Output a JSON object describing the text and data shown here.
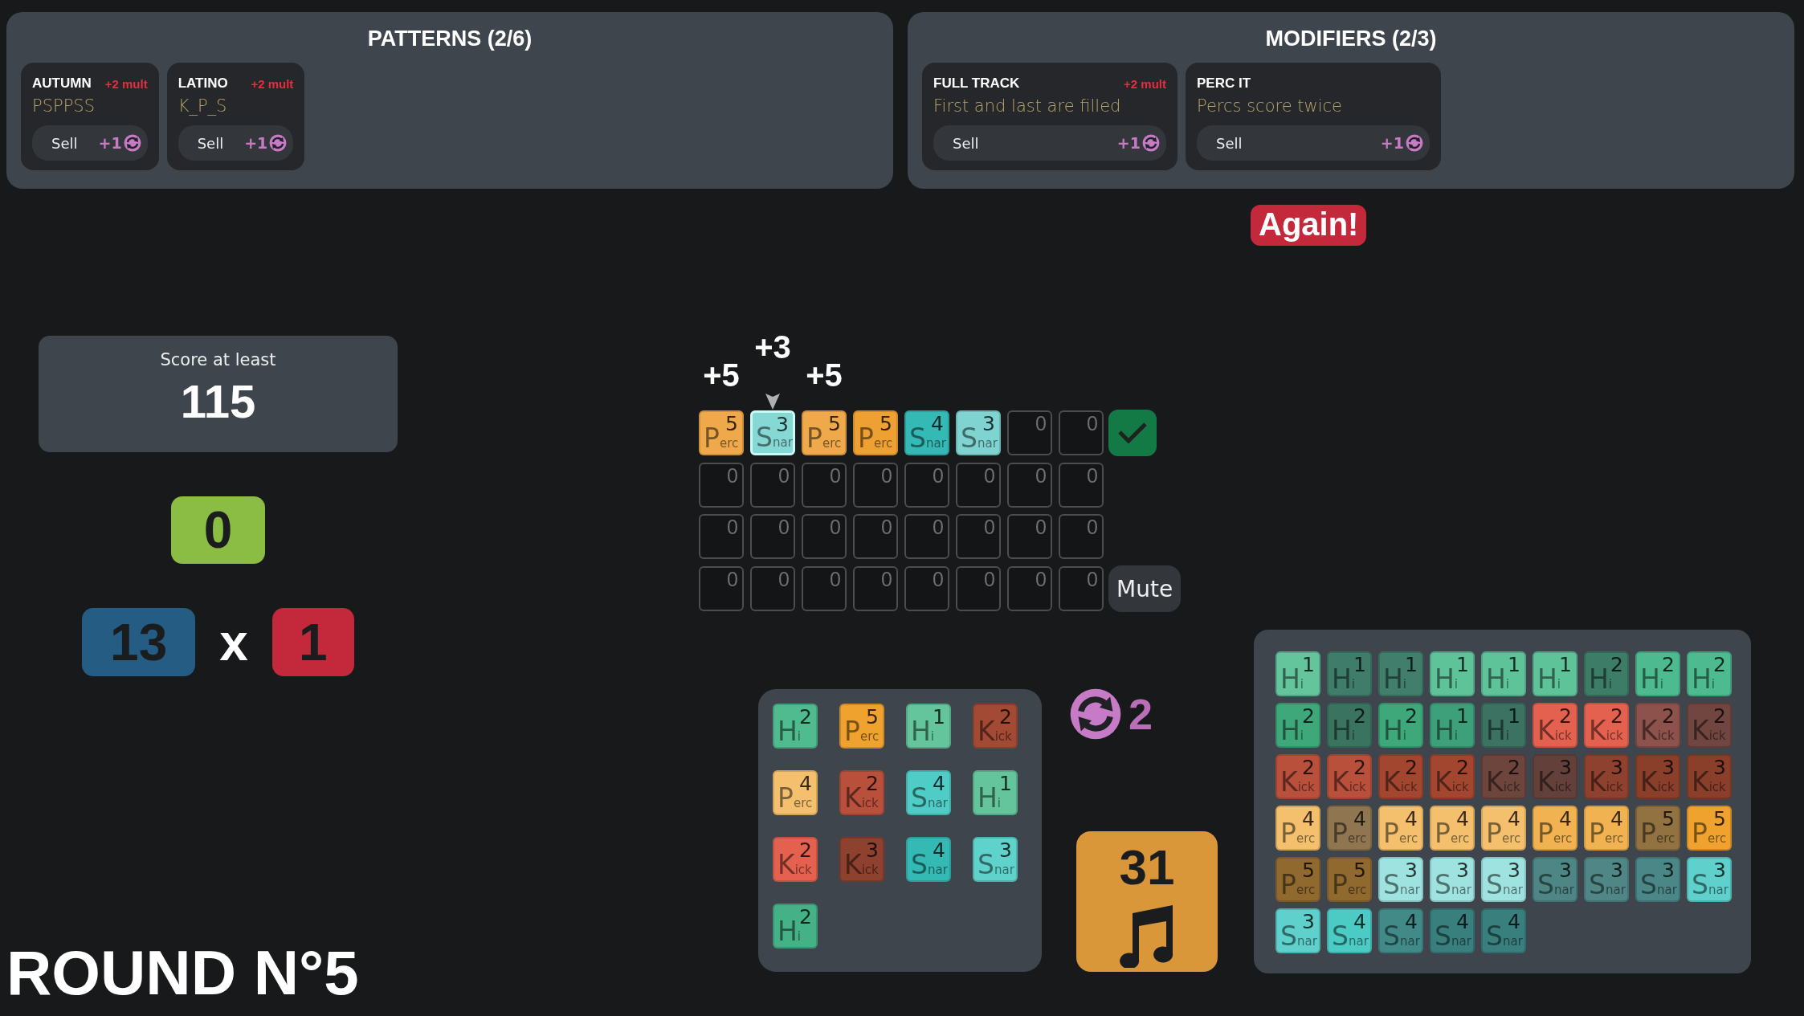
{
  "patterns": {
    "title": "PATTERNS (2/6)",
    "cards": [
      {
        "name": "AUTUMN",
        "bonus": "+2 mult",
        "description": "PSPPSS",
        "sell_label": "Sell",
        "sell_value": "+1"
      },
      {
        "name": "LATINO",
        "bonus": "+2 mult",
        "description": "K_P_S",
        "sell_label": "Sell",
        "sell_value": "+1"
      }
    ]
  },
  "modifiers": {
    "title": "MODIFIERS (2/3)",
    "cards": [
      {
        "name": "FULL TRACK",
        "bonus": "+2 mult",
        "description": "First and last are filled",
        "sell_label": "Sell",
        "sell_value": "+1"
      },
      {
        "name": "PERC IT",
        "description": "Percs score twice",
        "sell_label": "Sell",
        "sell_value": "+1"
      }
    ]
  },
  "again_badge": "Again!",
  "target": {
    "label": "Score at least",
    "value": "115"
  },
  "score": "0",
  "chips": "13",
  "times": "x",
  "mult": "1",
  "round_title": "ROUND N°5",
  "grid": {
    "rows": [
      {
        "cells": [
          {
            "kind": "tile",
            "label": "P$_{erc}$",
            "value": "5",
            "color": "#efa94a",
            "selected": false,
            "popup": "+5"
          },
          {
            "kind": "tile",
            "label": "S$_{nar}$",
            "value": "3",
            "color": "#86d8d5",
            "selected": true,
            "popup": "+3"
          },
          {
            "kind": "tile",
            "label": "P$_{erc}$",
            "value": "5",
            "color": "#efa94a",
            "selected": false,
            "popup": "+5"
          },
          {
            "kind": "tile",
            "label": "P$_{erc}$",
            "value": "5",
            "color": "#eea132",
            "selected": false
          },
          {
            "kind": "tile",
            "label": "S$_{nar}$",
            "value": "4",
            "color": "#35b9b4",
            "selected": false
          },
          {
            "kind": "tile",
            "label": "S$_{nar}$",
            "value": "3",
            "color": "#7fd4d1",
            "selected": false
          },
          {
            "kind": "empty",
            "value": "0",
            "selected": false
          },
          {
            "kind": "empty",
            "value": "0",
            "selected": false
          }
        ],
        "action": {
          "kind": "confirm"
        }
      },
      {
        "cells": [
          {
            "kind": "empty",
            "value": "0",
            "selected": false
          },
          {
            "kind": "empty",
            "value": "0",
            "selected": false
          },
          {
            "kind": "empty",
            "value": "0",
            "selected": false
          },
          {
            "kind": "empty",
            "value": "0",
            "selected": false
          },
          {
            "kind": "empty",
            "value": "0",
            "selected": false
          },
          {
            "kind": "empty",
            "value": "0",
            "selected": false
          },
          {
            "kind": "empty",
            "value": "0",
            "selected": false
          },
          {
            "kind": "empty",
            "value": "0",
            "selected": false
          }
        ]
      },
      {
        "cells": [
          {
            "kind": "empty",
            "value": "0",
            "selected": false
          },
          {
            "kind": "empty",
            "value": "0",
            "selected": false
          },
          {
            "kind": "empty",
            "value": "0",
            "selected": false
          },
          {
            "kind": "empty",
            "value": "0",
            "selected": false
          },
          {
            "kind": "empty",
            "value": "0",
            "selected": false
          },
          {
            "kind": "empty",
            "value": "0",
            "selected": false
          },
          {
            "kind": "empty",
            "value": "0",
            "selected": false
          },
          {
            "kind": "empty",
            "value": "0",
            "selected": false
          }
        ]
      },
      {
        "cells": [
          {
            "kind": "empty",
            "value": "0",
            "selected": false
          },
          {
            "kind": "empty",
            "value": "0",
            "selected": false
          },
          {
            "kind": "empty",
            "value": "0",
            "selected": false
          },
          {
            "kind": "empty",
            "value": "0",
            "selected": false
          },
          {
            "kind": "empty",
            "value": "0",
            "selected": false
          },
          {
            "kind": "empty",
            "value": "0",
            "selected": false
          },
          {
            "kind": "empty",
            "value": "0",
            "selected": false
          },
          {
            "kind": "empty",
            "value": "0",
            "selected": false
          }
        ],
        "action": {
          "kind": "mute",
          "label": "Mute"
        }
      }
    ]
  },
  "hand": {
    "tiles": [
      {
        "label": "H$_{i}$",
        "value": "2",
        "color": "#4fbb8f"
      },
      {
        "label": "P$_{erc}$",
        "value": "5",
        "color": "#f0a22e"
      },
      {
        "label": "H$_{i}$",
        "value": "1",
        "color": "#64c49c"
      },
      {
        "label": "K$_{ick}$",
        "value": "2",
        "color": "#a24a33"
      },
      {
        "label": "P$_{erc}$",
        "value": "4",
        "color": "#f5c06e"
      },
      {
        "label": "K$_{ick}$",
        "value": "2",
        "color": "#b9503c"
      },
      {
        "label": "S$_{nar}$",
        "value": "4",
        "color": "#4fccc6"
      },
      {
        "label": "H$_{i}$",
        "value": "1",
        "color": "#64c49c"
      },
      {
        "label": "K$_{ick}$",
        "value": "2",
        "color": "#e5614f"
      },
      {
        "label": "K$_{ick}$",
        "value": "3",
        "color": "#8e412e"
      },
      {
        "label": "S$_{nar}$",
        "value": "4",
        "color": "#35b9b4"
      },
      {
        "label": "S$_{nar}$",
        "value": "3",
        "color": "#60d2cc"
      },
      {
        "label": "H$_{i}$",
        "value": "2",
        "color": "#45b187"
      }
    ]
  },
  "rerolls": "2",
  "deck_count": "31",
  "deck": {
    "tiles": [
      {
        "label": "H$_{i}$",
        "value": "1",
        "color": "#64c49c"
      },
      {
        "label": "H$_{i}$",
        "value": "1",
        "color": "#3f7d6a"
      },
      {
        "label": "H$_{i}$",
        "value": "1",
        "color": "#417f6c"
      },
      {
        "label": "H$_{i}$",
        "value": "1",
        "color": "#5fc39a"
      },
      {
        "label": "H$_{i}$",
        "value": "1",
        "color": "#5fc39a"
      },
      {
        "label": "H$_{i}$",
        "value": "1",
        "color": "#5fc39a"
      },
      {
        "label": "H$_{i}$",
        "value": "2",
        "color": "#3d7c67"
      },
      {
        "label": "H$_{i}$",
        "value": "2",
        "color": "#4dba90"
      },
      {
        "label": "H$_{i}$",
        "value": "2",
        "color": "#4dba90"
      },
      {
        "label": "H$_{i}$",
        "value": "2",
        "color": "#3ea87a"
      },
      {
        "label": "H$_{i}$",
        "value": "2",
        "color": "#3a7461"
      },
      {
        "label": "H$_{i}$",
        "value": "2",
        "color": "#3ea87a"
      },
      {
        "label": "H$_{i}$",
        "value": "1",
        "color": "#3ea07a"
      },
      {
        "label": "H$_{i}$",
        "value": "1",
        "color": "#3b7262"
      },
      {
        "label": "K$_{ick}$",
        "value": "2",
        "color": "#e5614f"
      },
      {
        "label": "K$_{ick}$",
        "value": "2",
        "color": "#e5614f"
      },
      {
        "label": "K$_{ick}$",
        "value": "2",
        "color": "#8c524b"
      },
      {
        "label": "K$_{ick}$",
        "value": "2",
        "color": "#714640"
      },
      {
        "label": "K$_{ick}$",
        "value": "2",
        "color": "#b9503c"
      },
      {
        "label": "K$_{ick}$",
        "value": "2",
        "color": "#b9503c"
      },
      {
        "label": "K$_{ick}$",
        "value": "2",
        "color": "#a3462f"
      },
      {
        "label": "K$_{ick}$",
        "value": "2",
        "color": "#a3462f"
      },
      {
        "label": "K$_{ick}$",
        "value": "2",
        "color": "#6d453d"
      },
      {
        "label": "K$_{ick}$",
        "value": "3",
        "color": "#63413a"
      },
      {
        "label": "K$_{ick}$",
        "value": "3",
        "color": "#8e412e"
      },
      {
        "label": "K$_{ick}$",
        "value": "3",
        "color": "#8a3f2b"
      },
      {
        "label": "K$_{ick}$",
        "value": "3",
        "color": "#8a3f2b"
      },
      {
        "label": "P$_{erc}$",
        "value": "4",
        "color": "#f5c06e"
      },
      {
        "label": "P$_{erc}$",
        "value": "4",
        "color": "#8f7650"
      },
      {
        "label": "P$_{erc}$",
        "value": "4",
        "color": "#f5c06e"
      },
      {
        "label": "P$_{erc}$",
        "value": "4",
        "color": "#f5c06e"
      },
      {
        "label": "P$_{erc}$",
        "value": "4",
        "color": "#f5c06e"
      },
      {
        "label": "P$_{erc}$",
        "value": "4",
        "color": "#f1b252"
      },
      {
        "label": "P$_{erc}$",
        "value": "4",
        "color": "#f1b252"
      },
      {
        "label": "P$_{erc}$",
        "value": "5",
        "color": "#927240"
      },
      {
        "label": "P$_{erc}$",
        "value": "5",
        "color": "#f0a22e"
      },
      {
        "label": "P$_{erc}$",
        "value": "5",
        "color": "#90692f"
      },
      {
        "label": "P$_{erc}$",
        "value": "5",
        "color": "#90692f"
      },
      {
        "label": "S$_{nar}$",
        "value": "3",
        "color": "#9fe3e0"
      },
      {
        "label": "S$_{nar}$",
        "value": "3",
        "color": "#9fe3e0"
      },
      {
        "label": "S$_{nar}$",
        "value": "3",
        "color": "#9fe3e0"
      },
      {
        "label": "S$_{nar}$",
        "value": "3",
        "color": "#4e8685"
      },
      {
        "label": "S$_{nar}$",
        "value": "3",
        "color": "#508685"
      },
      {
        "label": "S$_{nar}$",
        "value": "3",
        "color": "#4b8786"
      },
      {
        "label": "S$_{nar}$",
        "value": "3",
        "color": "#5fd0cb"
      },
      {
        "label": "S$_{nar}$",
        "value": "3",
        "color": "#5fd0cb"
      },
      {
        "label": "S$_{nar}$",
        "value": "4",
        "color": "#4ccbc5"
      },
      {
        "label": "S$_{nar}$",
        "value": "4",
        "color": "#428a88"
      },
      {
        "label": "S$_{nar}$",
        "value": "4",
        "color": "#387f7e"
      },
      {
        "label": "S$_{nar}$",
        "value": "4",
        "color": "#387f7e"
      }
    ]
  }
}
